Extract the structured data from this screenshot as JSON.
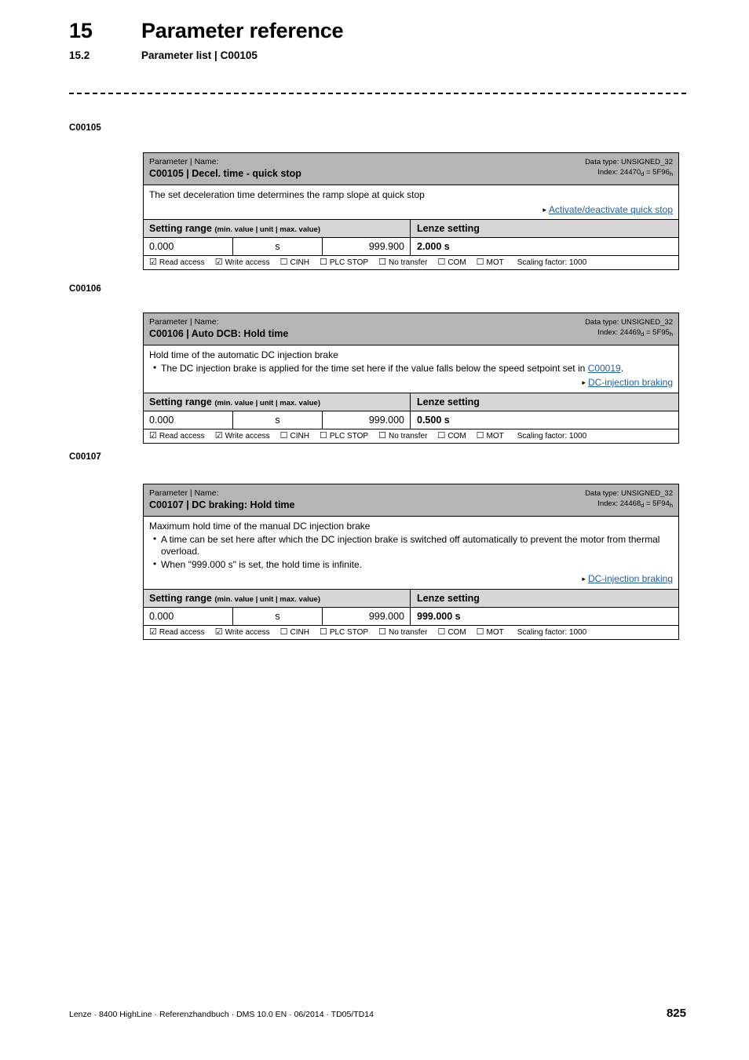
{
  "header": {
    "chapter_number": "15",
    "chapter_title": "Parameter reference",
    "section_number": "15.2",
    "section_title": "Parameter list | C00105"
  },
  "margin_labels": [
    {
      "text": "C00105"
    },
    {
      "text": "C00106"
    },
    {
      "text": "C00107"
    }
  ],
  "common": {
    "head_kicker": "Parameter | Name:",
    "setting_range_title": "Setting range ",
    "setting_range_sub": "(min. value | unit | max. value)",
    "lenze_setting_title": "Lenze setting",
    "scaling_label": "Scaling factor: 1000",
    "triangle_icon": "▸",
    "checked_box": "☑",
    "unchecked_box": "☐",
    "flags": [
      {
        "label": "Read access",
        "checked": true
      },
      {
        "label": "Write access",
        "checked": true
      },
      {
        "label": "CINH",
        "checked": false
      },
      {
        "label": "PLC STOP",
        "checked": false
      },
      {
        "label": "No transfer",
        "checked": false
      },
      {
        "label": "COM",
        "checked": false
      },
      {
        "label": "MOT",
        "checked": false
      }
    ]
  },
  "tables": [
    {
      "id": "C00105",
      "name": "C00105 | Decel. time - quick stop",
      "data_type_label": "Data type: UNSIGNED_32",
      "index_prefix": "Index: ",
      "index_dec": "24470",
      "index_dec_sub": "d",
      "index_eq": " = ",
      "index_hex": "5F96",
      "index_hex_sub": "h",
      "description": "The set deceleration time determines the ramp slope at quick stop",
      "bullets": [],
      "link": "Activate/deactivate quick stop",
      "min_value": "0.000",
      "unit": "s",
      "max_value": "999.900",
      "lenze_setting": "2.000 s"
    },
    {
      "id": "C00106",
      "name": "C00106 | Auto DCB: Hold time",
      "data_type_label": "Data type: UNSIGNED_32",
      "index_prefix": "Index: ",
      "index_dec": "24469",
      "index_dec_sub": "d",
      "index_eq": " = ",
      "index_hex": "5F95",
      "index_hex_sub": "h",
      "description": "Hold time of the automatic DC injection brake",
      "bullets": [
        {
          "pre": "The DC injection brake is applied for the time set here if the value falls below the speed setpoint set in ",
          "xref": "C00019",
          "post": "."
        }
      ],
      "link": "DC-injection braking",
      "min_value": "0.000",
      "unit": "s",
      "max_value": "999.000",
      "lenze_setting": "0.500 s"
    },
    {
      "id": "C00107",
      "name": "C00107 | DC braking: Hold time",
      "data_type_label": "Data type: UNSIGNED_32",
      "index_prefix": "Index: ",
      "index_dec": "24468",
      "index_dec_sub": "d",
      "index_eq": " = ",
      "index_hex": "5F94",
      "index_hex_sub": "h",
      "description": "Maximum hold time of the manual DC injection brake",
      "bullets": [
        {
          "pre": "A time can be set here after which the DC injection brake is switched off automatically to prevent the motor from thermal overload.",
          "xref": "",
          "post": ""
        },
        {
          "pre": "When \"999.000 s\" is set, the hold time is infinite.",
          "xref": "",
          "post": ""
        }
      ],
      "link": "DC-injection braking",
      "min_value": "0.000",
      "unit": "s",
      "max_value": "999.000",
      "lenze_setting": "999.000 s"
    }
  ],
  "footer": {
    "text": "Lenze · 8400 HighLine · Referenzhandbuch · DMS 10.0 EN · 06/2014 · TD05/TD14",
    "page_number": "825"
  }
}
